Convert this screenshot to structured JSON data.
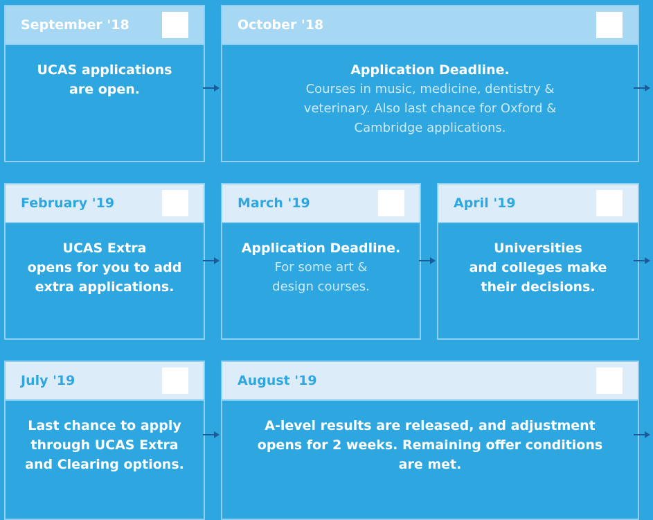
{
  "rows": [
    {
      "cards": [
        {
          "month": "September '18",
          "header_style": "dark",
          "bold_lines": [
            "UCAS applications",
            "are open."
          ],
          "thin_lines": []
        },
        {
          "month": "October '18",
          "header_style": "dark",
          "bold_lines": [
            "Application Deadline."
          ],
          "thin_lines": [
            "Courses in music, medicine, dentistry &",
            "veterinary. Also last chance for Oxford &",
            "Cambridge applications."
          ]
        }
      ]
    },
    {
      "cards": [
        {
          "month": "February '19",
          "header_style": "light",
          "bold_lines": [
            "UCAS Extra",
            "opens for you to add",
            "extra applications."
          ],
          "thin_lines": []
        },
        {
          "month": "March '19",
          "header_style": "light",
          "bold_lines": [
            "Application Deadline."
          ],
          "thin_lines": [
            "For some art &",
            "design courses."
          ]
        },
        {
          "month": "April '19",
          "header_style": "light",
          "bold_lines": [
            "Universities",
            "and colleges make",
            "their decisions."
          ],
          "thin_lines": []
        }
      ]
    },
    {
      "cards": [
        {
          "month": "July '19",
          "header_style": "light",
          "bold_lines": [
            "Last chance to apply",
            "through UCAS Extra",
            "and Clearing options."
          ],
          "thin_lines": []
        },
        {
          "month": "August '19",
          "header_style": "light",
          "bold_lines": [
            "A-level results are released, and adjustment",
            "opens for 2 weeks. Remaining offer conditions",
            "are met."
          ],
          "thin_lines": []
        }
      ]
    }
  ],
  "colors": {
    "background": "#2ea7e0",
    "border": "#8fd0f2",
    "header_dark": "#a6d7f3",
    "header_light": "#dcedf9",
    "arrow": "#1d5a9a"
  }
}
